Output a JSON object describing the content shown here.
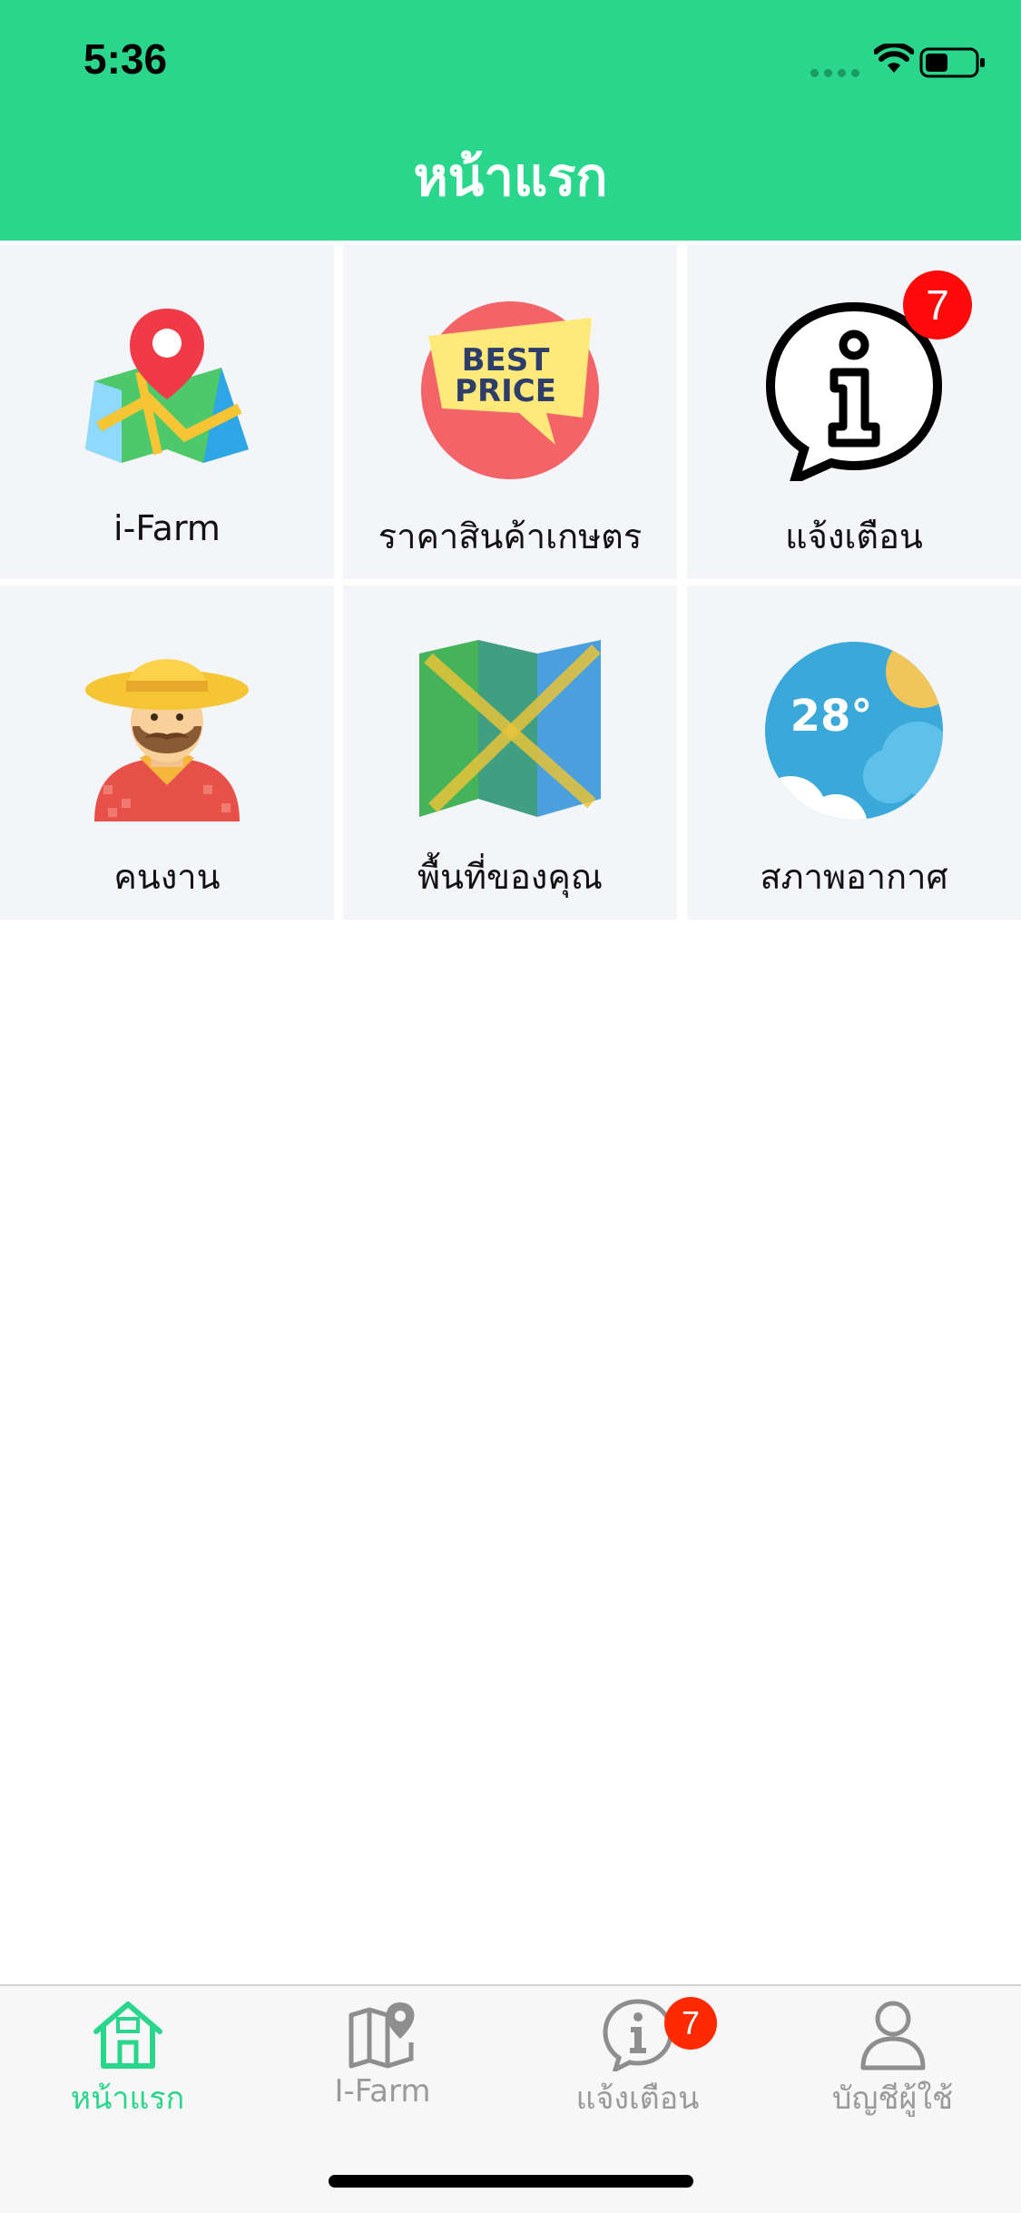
{
  "status_bar": {
    "time": "5:36"
  },
  "header": {
    "title": "หน้าแรก"
  },
  "tiles": [
    {
      "label": "i-Farm",
      "icon": "map-pin-icon"
    },
    {
      "label": "ราคาสินค้าเกษตร",
      "icon": "best-price-icon",
      "icon_text_line1": "BEST",
      "icon_text_line2": "PRICE"
    },
    {
      "label": "แจ้งเตือน",
      "icon": "info-bubble-icon",
      "badge": "7"
    },
    {
      "label": "คนงาน",
      "icon": "farmer-icon"
    },
    {
      "label": "พื้นที่ของคุณ",
      "icon": "folded-map-icon"
    },
    {
      "label": "สภาพอากาศ",
      "icon": "weather-icon",
      "icon_text": "28°"
    }
  ],
  "tabbar": {
    "items": [
      {
        "label": "หน้าแรก",
        "icon": "home-icon",
        "active": true
      },
      {
        "label": "I-Farm",
        "icon": "map-pin-icon"
      },
      {
        "label": "แจ้งเตือน",
        "icon": "info-bubble-icon",
        "badge": "7"
      },
      {
        "label": "บัญชีผู้ใช้",
        "icon": "user-icon"
      }
    ]
  },
  "colors": {
    "accent": "#2ad68b",
    "tile_bg": "#f4f5f9",
    "badge": "#ff0a0a"
  }
}
